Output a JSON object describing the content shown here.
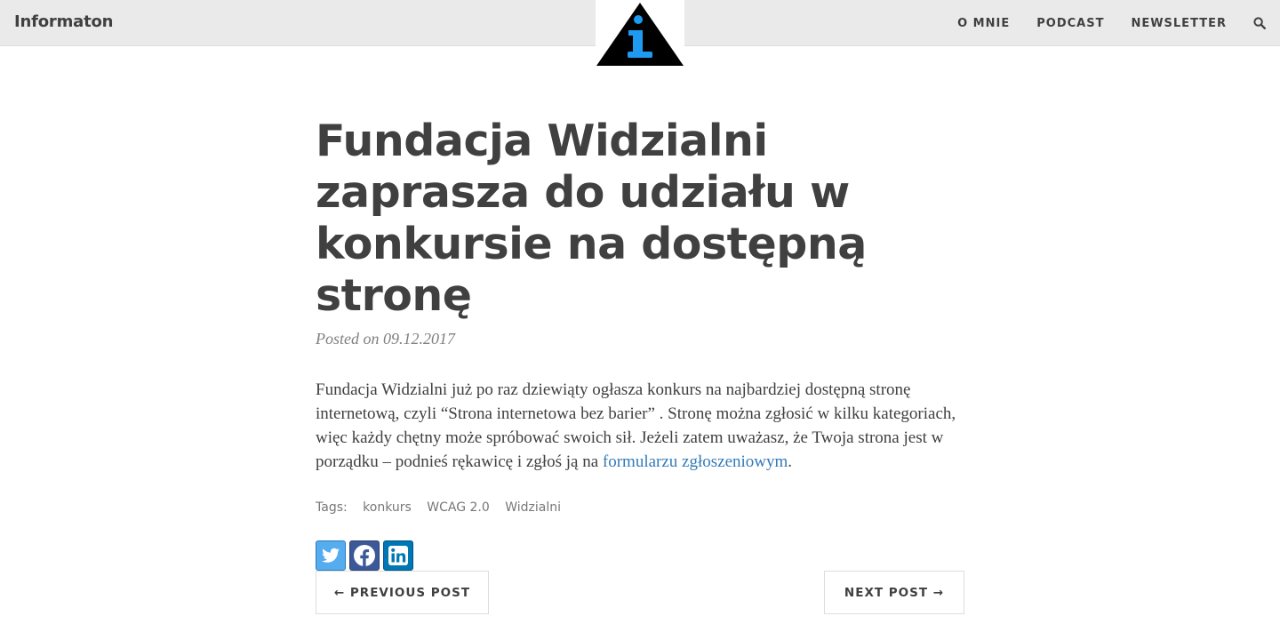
{
  "header": {
    "brand": "Informaton",
    "nav": [
      "O MNIE",
      "PODCAST",
      "NEWSLETTER"
    ],
    "search_icon": "search-icon",
    "logo_icon": "info-triangle-logo",
    "colors": {
      "bar": "#eaeaea",
      "logo_accent": "#1e9bf0"
    }
  },
  "post": {
    "title": "Fundacja Widzialni zaprasza do udziału w konkursie na dostępną stronę",
    "meta": "Posted on 09.12.2017",
    "body_text": "Fundacja Widzialni już po raz dziewiąty ogłasza konkurs na najbardziej dostępną stronę internetową, czyli “Strona internetowa bez barier” . Stronę można zgłosić w kilku kategoriach, więc każdy chętny może spróbować swoich sił. Jeżeli zatem uważasz, że Twoja strona jest w porządku – podnieś rękawicę i zgłoś ją na ",
    "link_text": "formularzu zgłoszeniowym",
    "body_end": ".",
    "tags_label": "Tags:",
    "tags": [
      "konkurs",
      "WCAG 2.0",
      "Widzialni"
    ],
    "share": [
      {
        "icon": "twitter-icon",
        "color": "#55acee"
      },
      {
        "icon": "facebook-icon",
        "color": "#3b5998"
      },
      {
        "icon": "linkedin-icon",
        "color": "#0077b5"
      }
    ]
  },
  "pager": {
    "prev": "← PREVIOUS POST",
    "next": "NEXT POST →"
  }
}
